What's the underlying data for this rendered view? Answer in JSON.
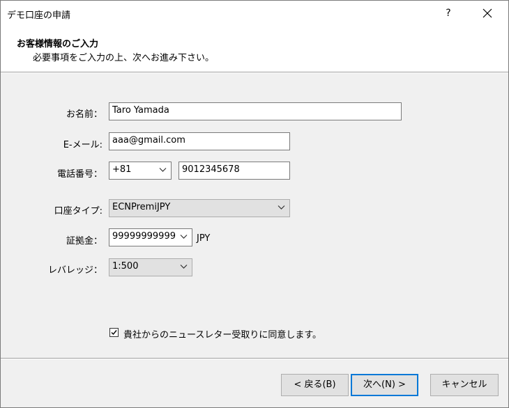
{
  "window": {
    "title": "デモ口座の申請",
    "help_label": "?"
  },
  "header": {
    "title": "お客様情報のご入力",
    "subtitle": "必要事項をご入力の上、次へお進み下さい。"
  },
  "form": {
    "name": {
      "label": "お名前：",
      "value": "Taro Yamada"
    },
    "email": {
      "label": "E-メール:",
      "value": "aaa@gmail.com"
    },
    "phone": {
      "label": "電話番号：",
      "country_code": "+81",
      "number": "9012345678"
    },
    "account_type": {
      "label": "口座タイプ:",
      "value": "ECNPremiJPY"
    },
    "deposit": {
      "label": "証拠金：",
      "value": "99999999999",
      "currency": "JPY"
    },
    "leverage": {
      "label": "レバレッジ：",
      "value": "1:500"
    }
  },
  "newsletter": {
    "label": "貴社からのニュースレター受取りに同意します。",
    "checked": true
  },
  "buttons": {
    "back": "< 戻る(B)",
    "next": "次へ(N) >",
    "cancel": "キャンセル"
  }
}
